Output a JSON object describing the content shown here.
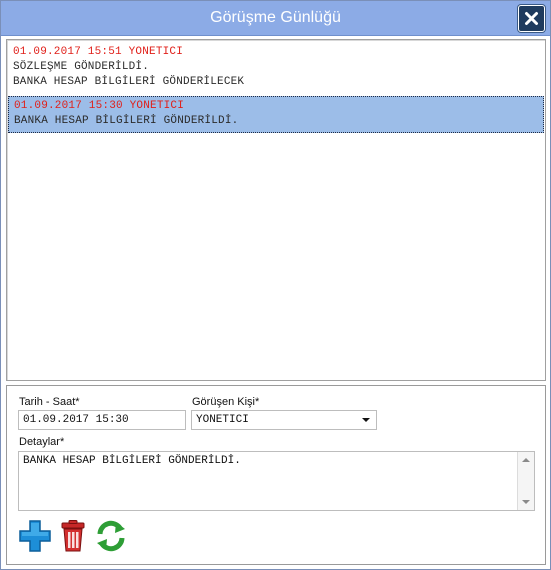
{
  "window": {
    "title": "Görüşme Günlüğü",
    "close_icon": "close-icon"
  },
  "log": {
    "entries": [
      {
        "header": "01.09.2017 15:51 YONETICI",
        "lines": [
          "SÖZLEŞME GÖNDERİLDİ.",
          "BANKA HESAP BİLGİLERİ GÖNDERİLECEK"
        ],
        "selected": false
      },
      {
        "header": "01.09.2017 15:30 YONETICI",
        "lines": [
          "BANKA HESAP BİLGİLERİ GÖNDERİLDİ."
        ],
        "selected": true
      }
    ]
  },
  "form": {
    "datetime_label": "Tarih - Saat*",
    "datetime_value": "01.09.2017 15:30",
    "person_label": "Görüşen Kişi*",
    "person_value": "YONETICI",
    "details_label": "Detaylar*",
    "details_value": "BANKA HESAP BİLGİLERİ GÖNDERİLDİ."
  },
  "toolbar": {
    "add_icon": "add-icon",
    "delete_icon": "trash-icon",
    "refresh_icon": "refresh-icon"
  },
  "colors": {
    "titlebar": "#8cabe6",
    "entry_header": "#e0201a",
    "selected_row": "#9cbde8"
  }
}
